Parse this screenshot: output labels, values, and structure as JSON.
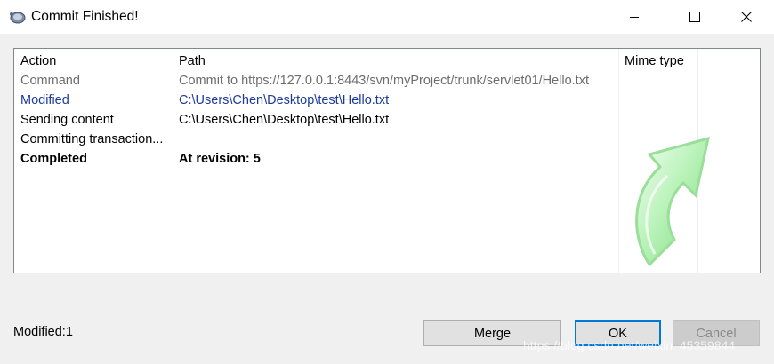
{
  "window": {
    "title": "Commit Finished!"
  },
  "table": {
    "headers": {
      "action": "Action",
      "path": "Path",
      "mime": "Mime type"
    },
    "rows": [
      {
        "action": "Command",
        "path": "Commit to https://127.0.0.1:8443/svn/myProject/trunk/servlet01/Hello.txt",
        "style": "gray"
      },
      {
        "action": "Modified",
        "path": "C:\\Users\\Chen\\Desktop\\test\\Hello.txt",
        "style": "blue"
      },
      {
        "action": "Sending content",
        "path": "C:\\Users\\Chen\\Desktop\\test\\Hello.txt",
        "style": "normal"
      },
      {
        "action": "Committing transaction...",
        "path": "",
        "style": "normal"
      },
      {
        "action": "Completed",
        "path": "At revision: 5",
        "style": "bold"
      }
    ]
  },
  "status": {
    "text": "Modified:1"
  },
  "buttons": {
    "merge": "Merge",
    "ok": "OK",
    "cancel": "Cancel"
  },
  "watermark": "https://blog.csdn.net/weixin_45359844",
  "colors": {
    "link_blue": "#1c3a9b",
    "ok_border": "#0078d7",
    "arrow_green": "#7be07b"
  }
}
